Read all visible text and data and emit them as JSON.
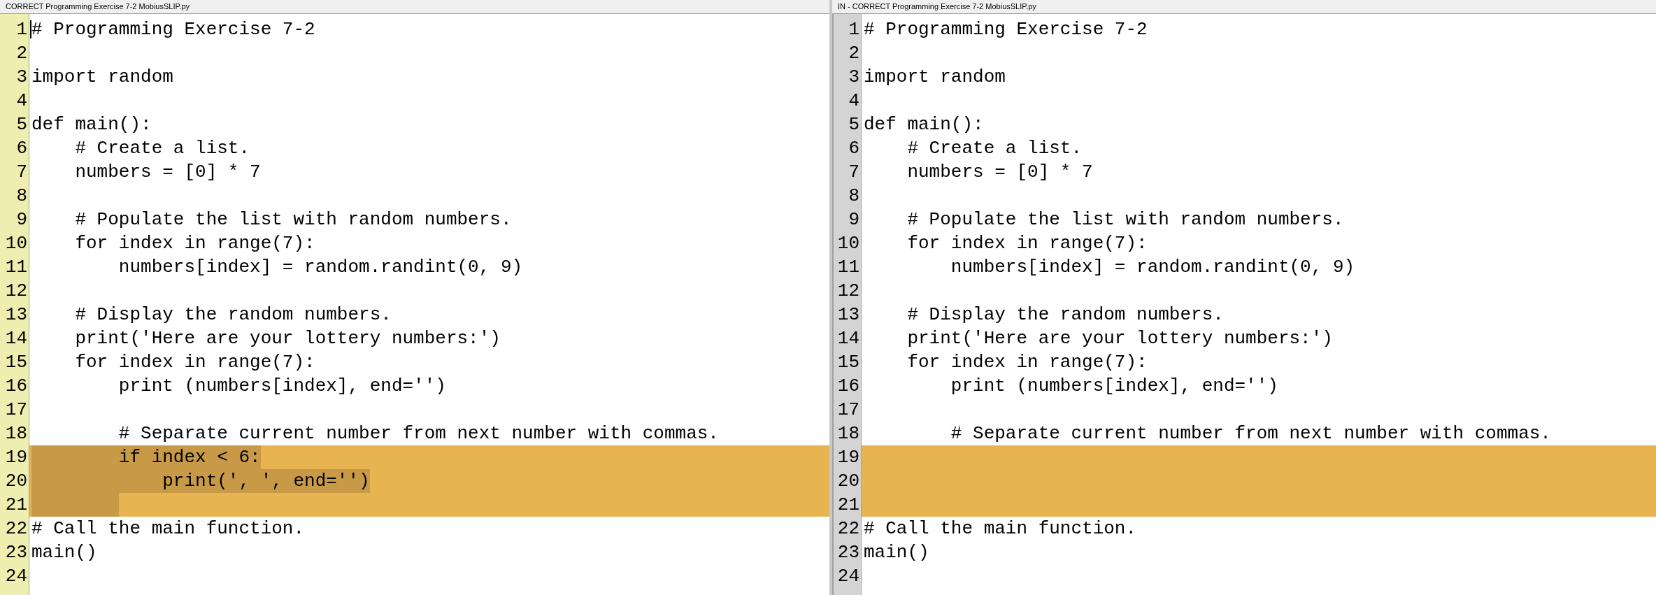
{
  "panes": [
    {
      "title": "CORRECT Programming Exercise 7-2 MobiusSLIP.py",
      "kind": "editable",
      "focused": true,
      "lines": [
        {
          "number": "1",
          "text": "# Programming Exercise 7-2",
          "changed": false,
          "selected": false
        },
        {
          "number": "2",
          "changed": false,
          "selected": false
        },
        {
          "number": "3",
          "text": "import random",
          "changed": false,
          "selected": false
        },
        {
          "number": "4",
          "changed": false,
          "selected": false
        },
        {
          "number": "5",
          "text": "def main():",
          "changed": false,
          "selected": false
        },
        {
          "number": "6",
          "text": "    # Create a list.",
          "changed": false,
          "selected": false
        },
        {
          "number": "7",
          "text": "    numbers = [0] * 7",
          "changed": false,
          "selected": false
        },
        {
          "number": "8",
          "changed": false,
          "selected": false
        },
        {
          "number": "9",
          "text": "    # Populate the list with random numbers.",
          "changed": false,
          "selected": false
        },
        {
          "number": "10",
          "text": "    for index in range(7):",
          "changed": false,
          "selected": false
        },
        {
          "number": "11",
          "text": "        numbers[index] = random.randint(0, 9)",
          "changed": false,
          "selected": false
        },
        {
          "number": "12",
          "changed": false,
          "selected": false
        },
        {
          "number": "13",
          "text": "    # Display the random numbers.",
          "changed": false,
          "selected": false
        },
        {
          "number": "14",
          "text": "    print('Here are your lottery numbers:')",
          "changed": false,
          "selected": false
        },
        {
          "number": "15",
          "text": "    for index in range(7):",
          "changed": false,
          "selected": false
        },
        {
          "number": "16",
          "text": "        print (numbers[index], end='')",
          "changed": false,
          "selected": false
        },
        {
          "number": "17",
          "changed": false,
          "selected": false
        },
        {
          "number": "18",
          "text": "        # Separate current number from next number with commas.",
          "changed": false,
          "selected": false
        },
        {
          "number": "19",
          "text": "        if index < 6:",
          "changed": true,
          "selected": true
        },
        {
          "number": "20",
          "text": "            print(', ', end='')",
          "changed": true,
          "selected": true
        },
        {
          "number": "21",
          "changed": true,
          "selected": true
        },
        {
          "number": "22",
          "text": "# Call the main function.",
          "changed": false,
          "selected": false
        },
        {
          "number": "23",
          "text": "main()",
          "changed": false,
          "selected": false
        },
        {
          "number": "24",
          "changed": false,
          "selected": false
        }
      ]
    },
    {
      "title": "IN - CORRECT Programming Exercise 7-2 MobiusSLIP.py",
      "kind": "readonly",
      "lines": [
        {
          "number": "1",
          "text": "# Programming Exercise 7-2",
          "changed": false,
          "selected": false
        },
        {
          "number": "2",
          "changed": false,
          "selected": false
        },
        {
          "number": "3",
          "text": "import random",
          "changed": false,
          "selected": false
        },
        {
          "number": "4",
          "changed": false,
          "selected": false
        },
        {
          "number": "5",
          "text": "def main():",
          "changed": false,
          "selected": false
        },
        {
          "number": "6",
          "text": "    # Create a list.",
          "changed": false,
          "selected": false
        },
        {
          "number": "7",
          "text": "    numbers = [0] * 7",
          "changed": false,
          "selected": false
        },
        {
          "number": "8",
          "changed": false,
          "selected": false
        },
        {
          "number": "9",
          "text": "    # Populate the list with random numbers.",
          "changed": false,
          "selected": false
        },
        {
          "number": "10",
          "text": "    for index in range(7):",
          "changed": false,
          "selected": false
        },
        {
          "number": "11",
          "text": "        numbers[index] = random.randint(0, 9)",
          "changed": false,
          "selected": false
        },
        {
          "number": "12",
          "changed": false,
          "selected": false
        },
        {
          "number": "13",
          "text": "    # Display the random numbers.",
          "changed": false,
          "selected": false
        },
        {
          "number": "14",
          "text": "    print('Here are your lottery numbers:')",
          "changed": false,
          "selected": false
        },
        {
          "number": "15",
          "text": "    for index in range(7):",
          "changed": false,
          "selected": false
        },
        {
          "number": "16",
          "text": "        print (numbers[index], end='')",
          "changed": false,
          "selected": false
        },
        {
          "number": "17",
          "changed": false,
          "selected": false
        },
        {
          "number": "18",
          "text": "        # Separate current number from next number with commas.",
          "changed": false,
          "selected": false
        },
        {
          "number": "19",
          "changed": true,
          "selected": false
        },
        {
          "number": "20",
          "changed": true,
          "selected": false
        },
        {
          "number": "21",
          "changed": true,
          "selected": false
        },
        {
          "number": "22",
          "text": "# Call the main function.",
          "changed": false,
          "selected": false
        },
        {
          "number": "23",
          "text": "main()",
          "changed": false,
          "selected": false
        },
        {
          "number": "24",
          "changed": false,
          "selected": false
        }
      ]
    }
  ]
}
